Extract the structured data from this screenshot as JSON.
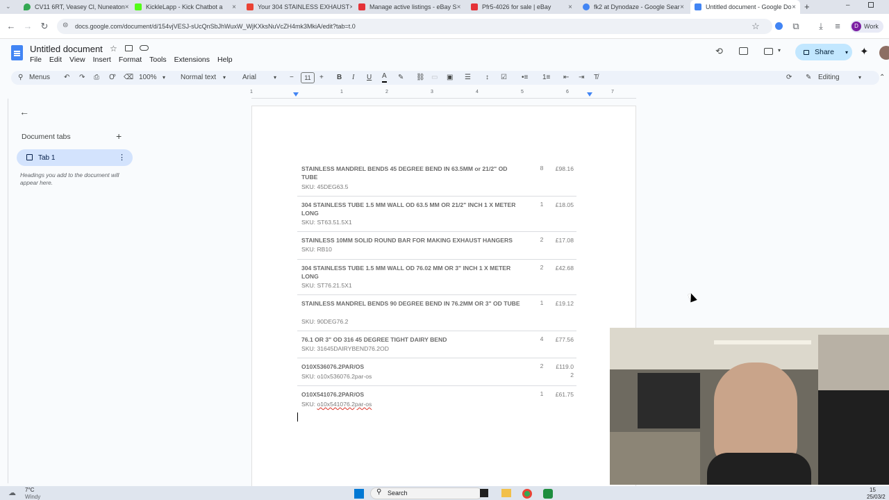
{
  "browser": {
    "tabs": [
      {
        "label": "CV11 6RT, Veasey Cl, Nuneaton",
        "color": "#34a853"
      },
      {
        "label": "KickleLapp - Kick Chatbot a",
        "color": "#53fc18"
      },
      {
        "label": "Your 304 STAINLESS EXHAUST",
        "color": "#ea4335"
      },
      {
        "label": "Manage active listings - eBay S",
        "color": "#e53238"
      },
      {
        "label": "Pfr5-4026 for sale | eBay",
        "color": "#e53238"
      },
      {
        "label": "fk2 at Dynodaze - Google Sear",
        "color": "#4285f4"
      },
      {
        "label": "Untitled document - Google Do",
        "color": "#4285f4"
      }
    ],
    "url": "docs.google.com/document/d/154vjVESJ-sUcQnSbJhWuxW_WjKXksNuVcZH4mk3MkiA/edit?tab=t.0",
    "profile_label": "Work"
  },
  "doc": {
    "title": "Untitled document",
    "menus": [
      "File",
      "Edit",
      "View",
      "Insert",
      "Format",
      "Tools",
      "Extensions",
      "Help"
    ],
    "share_label": "Share",
    "toolbar": {
      "menus_search": "Menus",
      "zoom": "100%",
      "style": "Normal text",
      "font": "Arial",
      "font_size": "11",
      "mode": "Editing"
    },
    "ruler_numbers": [
      "1",
      "1",
      "2",
      "3",
      "4",
      "5",
      "6",
      "7"
    ]
  },
  "sidebar": {
    "heading": "Document tabs",
    "tab_label": "Tab 1",
    "hint": "Headings you add to the document will appear here."
  },
  "items": [
    {
      "title": "STAINLESS MANDREL BENDS 45 DEGREE BEND IN 63.5MM or 21/2\" OD TUBE",
      "sku": "SKU: 45DEG63.5",
      "qty": "8",
      "price": "£98.16"
    },
    {
      "title": "304 STAINLESS TUBE 1.5 MM WALL OD 63.5 MM OR 21/2\" INCH 1 X METER LONG",
      "sku": "SKU: ST63.51.5X1",
      "qty": "1",
      "price": "£18.05"
    },
    {
      "title": "STAINLESS 10MM SOLID ROUND BAR FOR MAKING EXHAUST HANGERS",
      "sku": "SKU: RB10",
      "qty": "2",
      "price": "£17.08"
    },
    {
      "title": "304 STAINLESS TUBE 1.5 MM WALL OD 76.02 MM OR 3\" INCH 1 X METER LONG",
      "sku": "SKU: ST76.21.5X1",
      "qty": "2",
      "price": "£42.68"
    },
    {
      "title": "STAINLESS MANDREL BENDS 90 DEGREE BEND IN 76.2MM OR 3\" OD TUBE",
      "sku": "SKU: 90DEG76.2",
      "qty": "1",
      "price": "£19.12"
    },
    {
      "title": "76.1 OR 3\" OD 316 45 DEGREE TIGHT DAIRY BEND",
      "sku": "SKU: 31645DAIRYBEND76.2OD",
      "qty": "4",
      "price": "£77.56"
    },
    {
      "title": "O10X536076.2PAR/OS",
      "sku": "SKU: o10x536076.2par-os",
      "qty": "2",
      "price": "£119.0 2"
    },
    {
      "title": "O10X541076.2PAR/OS",
      "sku_prefix": "SKU: ",
      "sku_code": "o10x541076.2par-os",
      "qty": "1",
      "price": "£61.75"
    }
  ],
  "taskbar": {
    "weather_temp": "7°C",
    "weather_desc": "Windy",
    "search_label": "Search",
    "time": "15",
    "date": "25/03/2"
  }
}
